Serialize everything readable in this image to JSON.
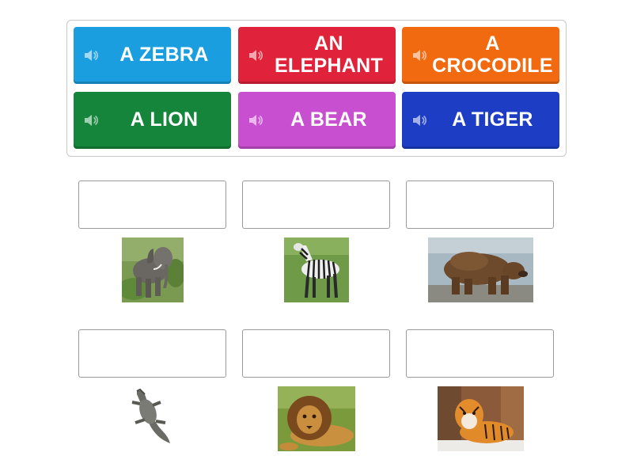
{
  "tiles": [
    {
      "label": "A ZEBRA",
      "color": "#1a9ee0"
    },
    {
      "label": "AN ELEPHANT",
      "color": "#e0233a"
    },
    {
      "label": "A CROCODILE",
      "color": "#f26a0f"
    },
    {
      "label": "A LION",
      "color": "#14853a"
    },
    {
      "label": "A BEAR",
      "color": "#c74fd0"
    },
    {
      "label": "A TIGER",
      "color": "#1c3dc4"
    }
  ],
  "icons": {
    "tile_icon": "speaker-icon"
  },
  "pictures": [
    "elephant",
    "zebra",
    "bear",
    "crocodile",
    "lion",
    "tiger"
  ]
}
